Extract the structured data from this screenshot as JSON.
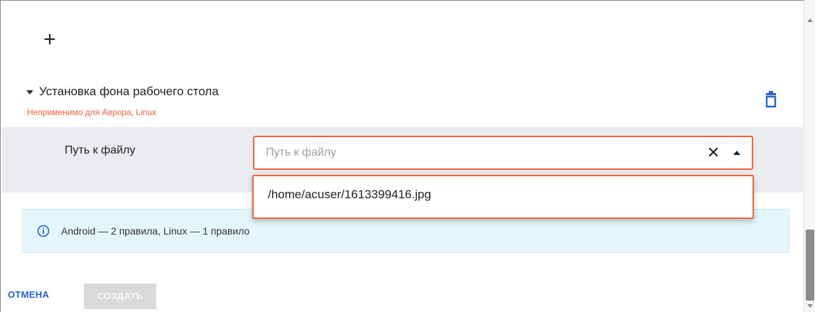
{
  "add_button": {
    "symbol": "+"
  },
  "section": {
    "title": "Установка фона рабочего стола",
    "warning": "Неприменимо для Аврора, Linux"
  },
  "field": {
    "label": "Путь к файлу",
    "placeholder": "Путь к файлу",
    "clear_symbol": "✕"
  },
  "dropdown": {
    "options": [
      "/home/acuser/1613399416.jpg"
    ]
  },
  "info": {
    "text": "Android — 2 правила, Linux — 1 правило"
  },
  "footer": {
    "cancel_label": "ОТМЕНА",
    "create_label": "СОЗДАТЬ"
  },
  "colors": {
    "accent_orange": "#f0643c",
    "link_blue": "#2563c9",
    "info_bg": "#e3f6fc",
    "row_grey": "#ebecf0"
  }
}
